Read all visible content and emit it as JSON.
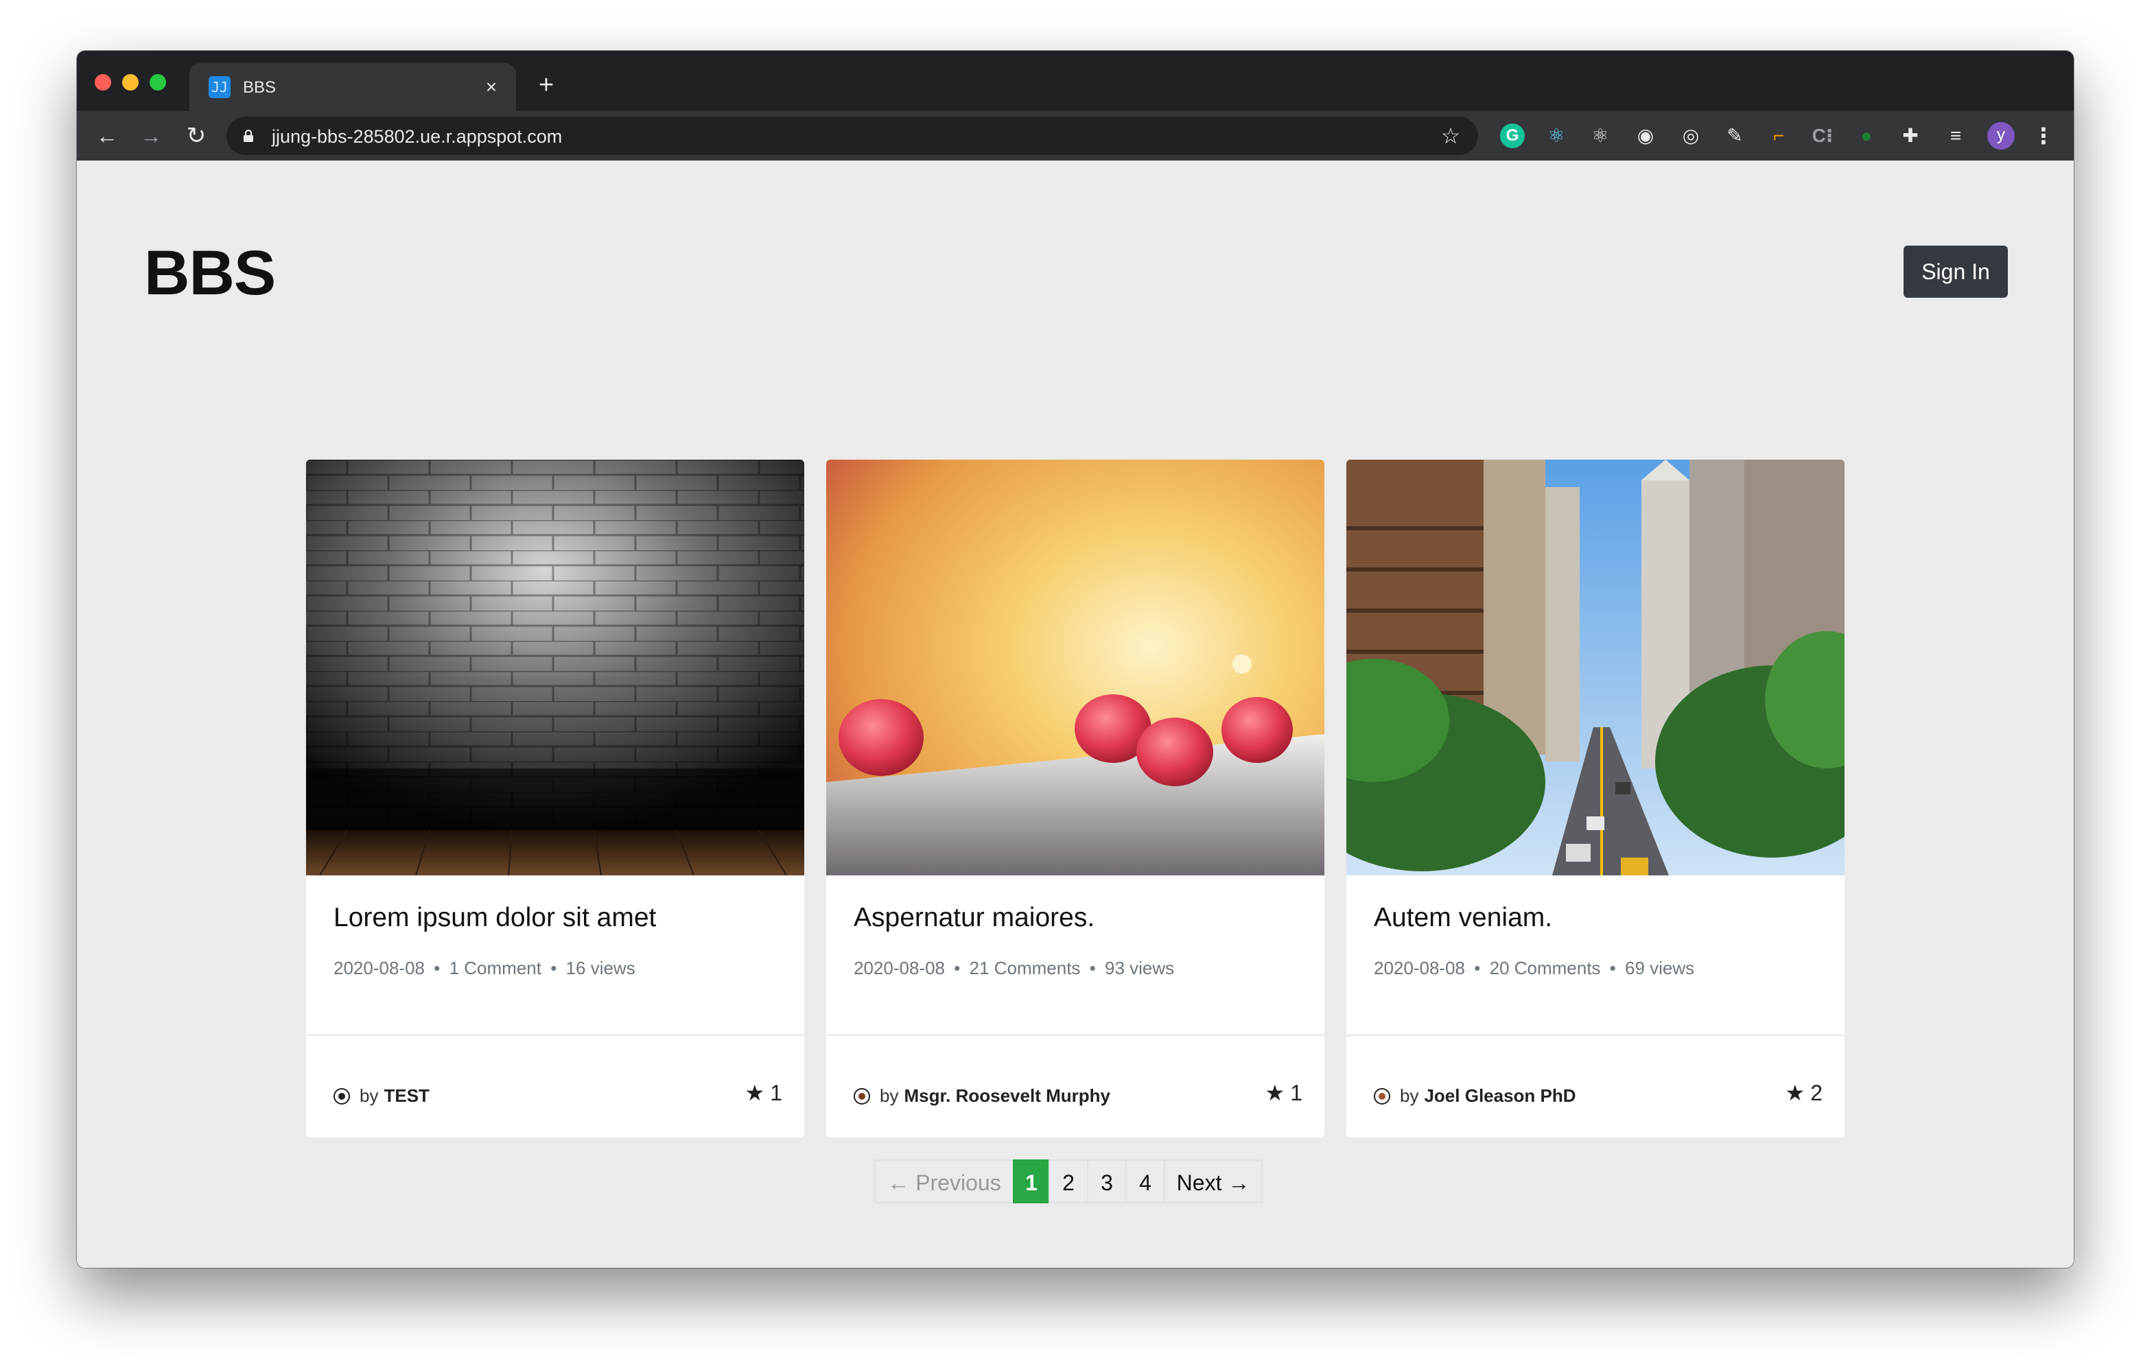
{
  "browser": {
    "tab_title": "BBS",
    "favicon_text": "JJ",
    "close_symbol": "×",
    "new_tab_symbol": "+",
    "url": "jjung-bbs-285802.ue.r.appspot.com",
    "avatar_letter": "y",
    "extension_icons": [
      "grammarly-icon",
      "react-devtools-icon",
      "react-icon",
      "circle-icon",
      "target-icon",
      "pen-icon",
      "bracket-icon",
      "css-icon",
      "green-icon",
      "puzzle-icon",
      "queue-icon"
    ]
  },
  "header": {
    "site_title": "BBS",
    "signin_label": "Sign In"
  },
  "posts": [
    {
      "title": "Lorem ipsum dolor sit amet",
      "date": "2020-08-08",
      "comments": "1 Comment",
      "views": "16 views",
      "author": "TEST",
      "rating": "1"
    },
    {
      "title": "Aspernatur maiores.",
      "date": "2020-08-08",
      "comments": "21 Comments",
      "views": "93 views",
      "author": "Msgr. Roosevelt Murphy",
      "rating": "1"
    },
    {
      "title": "Autem veniam.",
      "date": "2020-08-08",
      "comments": "20 Comments",
      "views": "69 views",
      "author": "Joel Gleason PhD",
      "rating": "2"
    }
  ],
  "labels": {
    "by": "by",
    "bullet": "•"
  },
  "pagination": {
    "previous": "← Previous",
    "pages": [
      "1",
      "2",
      "3",
      "4"
    ],
    "active": "1",
    "next": "Next →"
  },
  "colors": {
    "active_page": "#28a745",
    "signin_bg": "#343a40",
    "page_bg": "#ebebeb"
  }
}
